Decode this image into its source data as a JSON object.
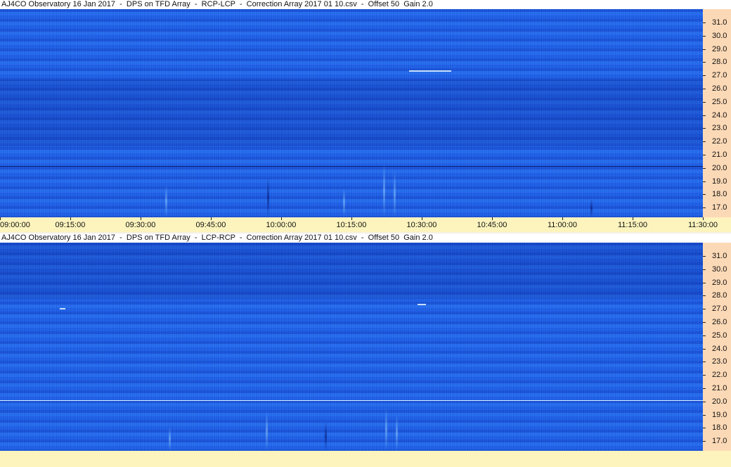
{
  "panel_top": {
    "title": "AJ4CO Observatory 16 Jan 2017  -  DPS on TFD Array  -  RCP-LCP  -  Correction Array 2017 01 10.csv  -  Offset 50  Gain 2.0",
    "yticks": [
      "31.0",
      "30.0",
      "29.0",
      "28.0",
      "27.0",
      "26.0",
      "25.0",
      "24.0",
      "23.0",
      "22.0",
      "21.0",
      "20.0",
      "19.0",
      "18.0",
      "17.0"
    ],
    "xticks": [
      "09:00:00",
      "09:15:00",
      "09:30:00",
      "09:45:00",
      "10:00:00",
      "10:15:00",
      "10:30:00",
      "10:45:00",
      "11:00:00",
      "11:15:00",
      "11:30:00"
    ],
    "line_color": "#0b1f73"
  },
  "panel_bottom": {
    "title": "AJ4CO Observatory 16 Jan 2017  -  DPS on TFD Array  -  LCP-RCP  -  Correction Array 2017 01 10.csv  -  Offset 50  Gain 2.0",
    "yticks": [
      "31.0",
      "30.0",
      "29.0",
      "28.0",
      "27.0",
      "26.0",
      "25.0",
      "24.0",
      "23.0",
      "22.0",
      "21.0",
      "20.0",
      "19.0",
      "18.0",
      "17.0"
    ],
    "line_color": "#d8f0ff"
  },
  "colors": {
    "spectrogram": "#1f63e8",
    "freq_axis_bg": "#fcd9b6",
    "time_axis_bg": "#fdf4bd"
  }
}
